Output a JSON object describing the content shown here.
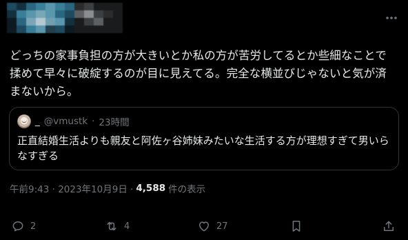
{
  "tweet": {
    "body": "どっちの家事負担の方が大きいとか私の方が苦労してるとか些細なことで\n揉めて早々に破綻するのが目に見えてる。完全な横並びじゃないと気が済\nまないから。",
    "quote": {
      "display_name": "_",
      "handle": "@vmustk",
      "separator": "·",
      "time": "23時間",
      "text": "正直結婚生活よりも親友と阿佐ヶ谷姉妹みたいな生活する方が理想すぎて男いら\nなすぎる"
    },
    "meta": {
      "timestamp": "午前9:43 · 2023年10月9日 ·",
      "views_count": "4,588",
      "views_label": "件の表示"
    },
    "actions": {
      "replies": "2",
      "reposts": "4",
      "likes": "27"
    }
  },
  "icons": {
    "more": "more-horizontal-icon",
    "reply": "reply-icon",
    "repost": "repost-icon",
    "like": "heart-icon",
    "bookmark": "bookmark-icon",
    "share": "share-icon"
  },
  "colors": {
    "background": "#000000",
    "text": "#e7e9ea",
    "muted": "#71767b",
    "border": "#2f3336"
  }
}
